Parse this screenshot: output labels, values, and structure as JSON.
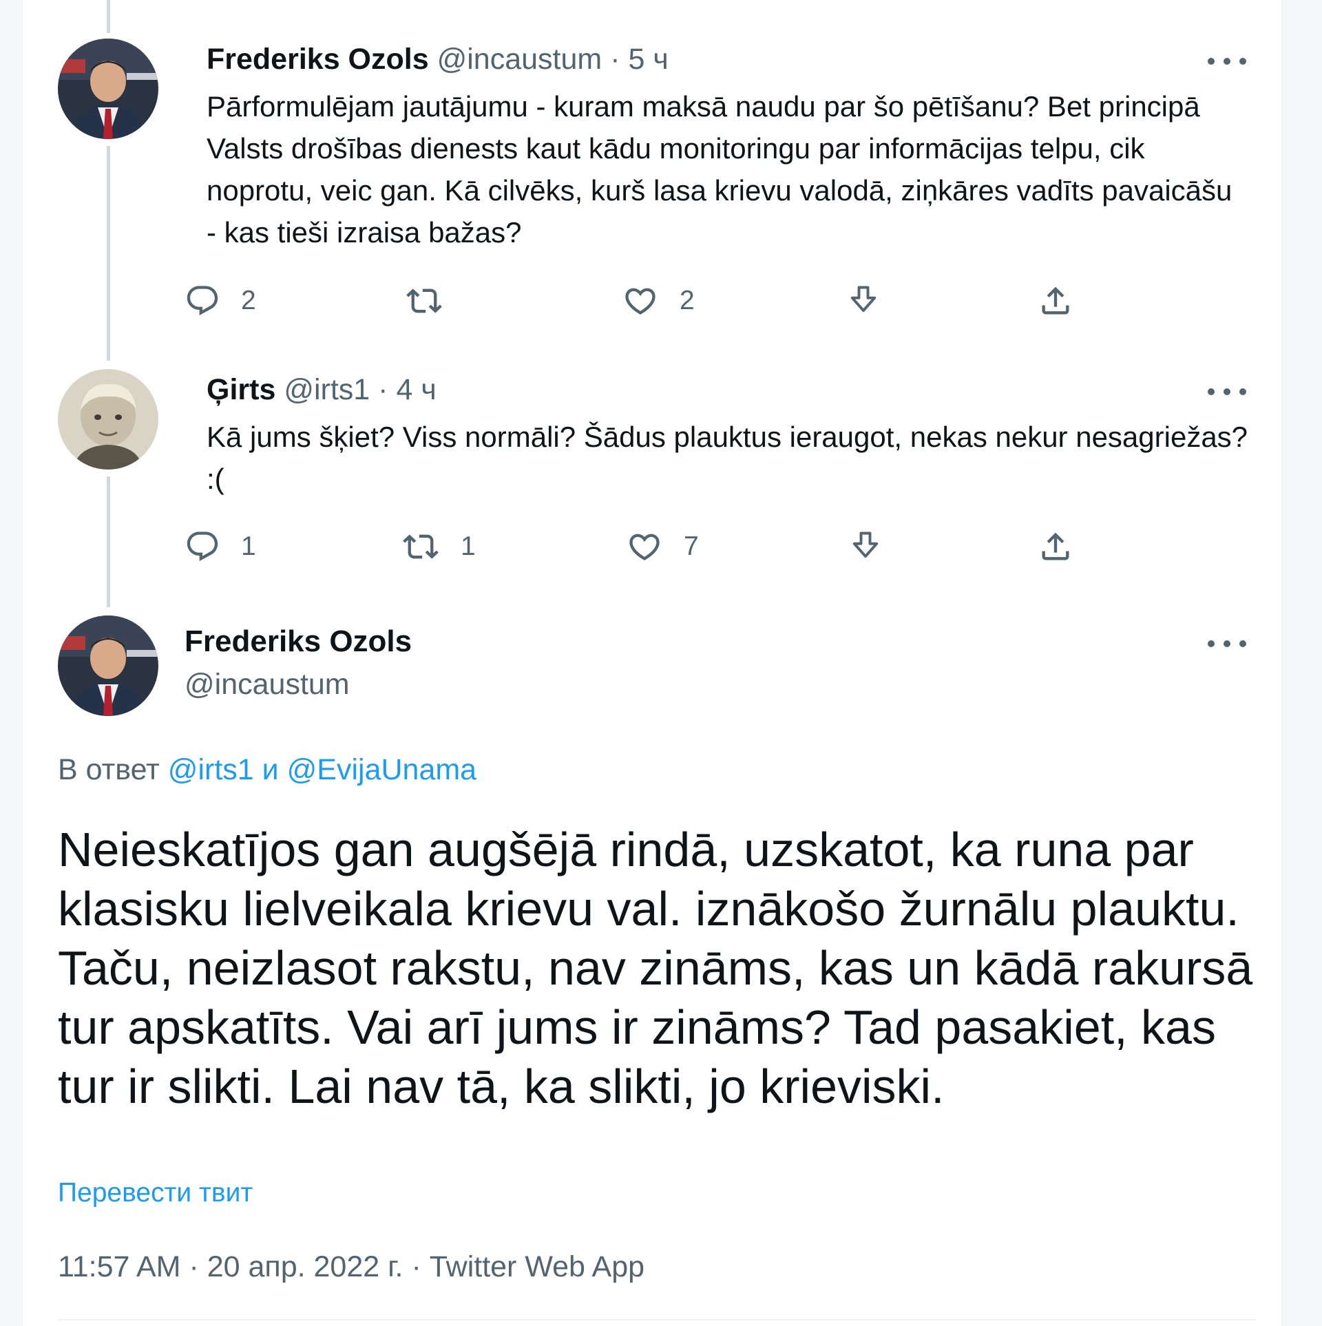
{
  "thread": {
    "tweet1": {
      "author_name": "Frederiks Ozols",
      "handle": "@incaustum",
      "separator": "·",
      "time": "5 ч",
      "text": "Pārformulējam jautājumu - kuram maksā naudu par šo pētīšanu? Bet principā Valsts drošības dienests kaut kādu monitoringu par informācijas telpu, cik noprotu, veic gan. Kā cilvēks, kurš lasa krievu valodā, ziņkāres vadīts pavaicāšu - kas tieši izraisa bažas?",
      "replies": "2",
      "retweets": "",
      "likes": "2"
    },
    "tweet2": {
      "author_name": "Ģirts",
      "handle": "@irts1",
      "separator": "·",
      "time": "4 ч",
      "text": "Kā jums šķiet? Viss normāli? Šādus plauktus ieraugot, nekas nekur nesagriežas? :(",
      "replies": "1",
      "retweets": "1",
      "likes": "7"
    }
  },
  "main_tweet": {
    "author_name": "Frederiks Ozols",
    "handle": "@incaustum",
    "reply_prefix": "В ответ",
    "reply_user1": "@irts1",
    "reply_conjunction": "и",
    "reply_user2": "@EvijaUnama",
    "text": "Neieskatījos gan augšējā rindā, uzskatot, ka runa par klasisku lielveikala krievu val. iznākošo žurnālu plauktu. Taču, neizlasot rakstu, nav zināms, kas un kādā rakursā tur apskatīts. Vai arī jums ir zināms? Tad pasakiet, kas tur ir slikti. Lai nav tā, ka slikti, jo krieviski.",
    "translate_label": "Перевести твит",
    "time": "11:57 AM",
    "separator": "·",
    "date": "20 апр. 2022 г.",
    "source": "Twitter Web App"
  },
  "icons": [
    "reply-icon",
    "retweet-icon",
    "like-icon",
    "bookmark-icon",
    "share-icon",
    "more-icon"
  ],
  "colors": {
    "link": "#1d9bf0",
    "secondary_text": "#536471",
    "primary_text": "#0f1419",
    "thread_line": "#cfd9de"
  }
}
